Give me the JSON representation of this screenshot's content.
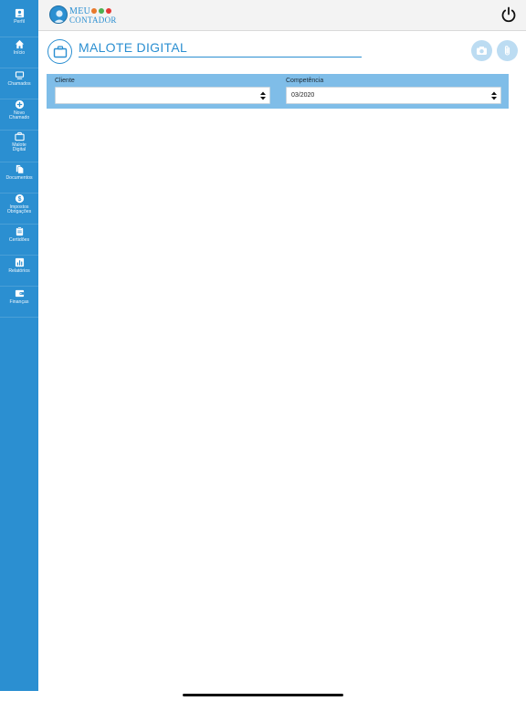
{
  "sidebar": {
    "items": [
      {
        "label": "Perfil",
        "icon": "profile-icon"
      },
      {
        "label": "Início",
        "icon": "home-icon"
      },
      {
        "label": "Chamados",
        "icon": "inbox-icon"
      },
      {
        "label": "Novo\nChamado",
        "icon": "add-circle-icon"
      },
      {
        "label": "Malote\nDigital",
        "icon": "briefcase-icon"
      },
      {
        "label": "Documentos",
        "icon": "documents-icon"
      },
      {
        "label": "Impostos\nObrigações",
        "icon": "dollar-icon"
      },
      {
        "label": "Certidões",
        "icon": "clipboard-icon"
      },
      {
        "label": "Relatórios",
        "icon": "bar-chart-icon"
      },
      {
        "label": "Finanças",
        "icon": "wallet-icon"
      }
    ]
  },
  "header": {
    "logo_line1": "MEU",
    "logo_line2": "CONTADOR",
    "logo_dots": [
      "#e8792b",
      "#4caf50",
      "#e53935"
    ]
  },
  "page": {
    "title": "MALOTE DIGITAL"
  },
  "filters": {
    "cliente_label": "Cliente",
    "cliente_value": "",
    "competencia_label": "Competência",
    "competencia_value": "03/2020"
  },
  "colors": {
    "accent": "#2b8fd1",
    "panel": "#7fbde8",
    "action_button": "#bcdcf2"
  }
}
